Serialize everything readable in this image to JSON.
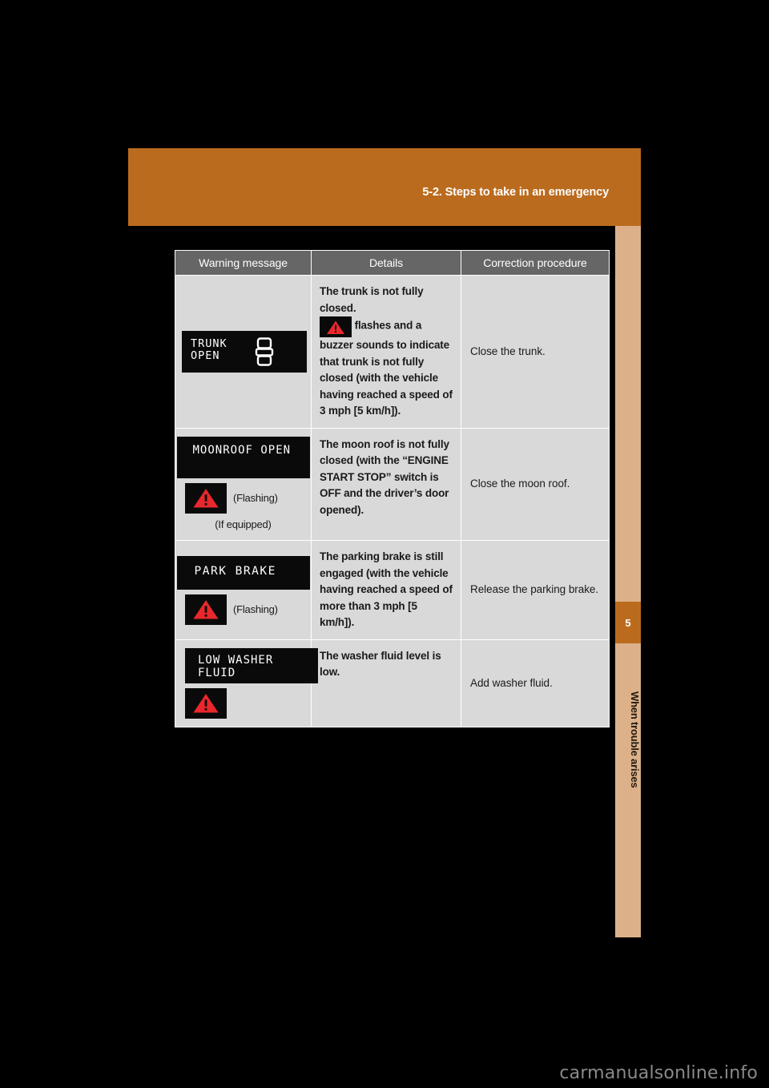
{
  "page": {
    "background_color": "#000000",
    "accent_color": "#bb6b1e",
    "sidebar_color": "#dcb189",
    "table_header_color": "#666666",
    "table_cell_color": "#d9d9d9",
    "warning_red": "#e8282c"
  },
  "section_header": {
    "title": "5-2. Steps to take in an emergency"
  },
  "thumb_index": {
    "chapter_number": "5",
    "chapter_label": "When trouble arises"
  },
  "table": {
    "headers": [
      "Warning message",
      "Details",
      "Correction procedure"
    ],
    "rows": [
      {
        "display": {
          "line1": "TRUNK",
          "line2": "OPEN",
          "icon": "car-trunk-open-icon"
        },
        "details_lead": "The trunk is not fully closed.",
        "details_body_prefix": "flashes and a buzzer sounds to indicate that trunk is not fully closed (with the vehicle having reached a speed of 3 mph [5 km/h]).",
        "warning_icon": "warning-triangle-icon",
        "correction": "Close the trunk.",
        "flashing_note": "",
        "equipped_note": ""
      },
      {
        "display": {
          "line1": "MOONROOF",
          "line2": "OPEN",
          "icon": ""
        },
        "details_lead": "",
        "details_body_prefix": "The moon roof is not fully closed (with the “ENGINE START STOP” switch is OFF and the driver’s door opened).",
        "warning_icon": "warning-triangle-icon",
        "correction": "Close the moon roof.",
        "flashing_note": "(Flashing)",
        "equipped_note": "(If equipped)"
      },
      {
        "display": {
          "line1": "PARK  BRAKE",
          "line2": "",
          "icon": ""
        },
        "details_lead": "",
        "details_body_prefix": "The parking brake is still engaged (with the vehicle having reached a speed of more than 3 mph [5 km/h]).",
        "warning_icon": "warning-triangle-icon",
        "correction": "Release the parking brake.",
        "flashing_note": "(Flashing)",
        "equipped_note": ""
      },
      {
        "display": {
          "line1": "LOW WASHER",
          "line2": "FLUID",
          "icon": ""
        },
        "details_lead": "",
        "details_body_prefix": "The washer fluid level is low.",
        "warning_icon": "warning-triangle-icon",
        "correction": "Add washer fluid.",
        "flashing_note": "",
        "equipped_note": ""
      }
    ]
  },
  "watermark": {
    "text": "carmanualsonline.info"
  }
}
